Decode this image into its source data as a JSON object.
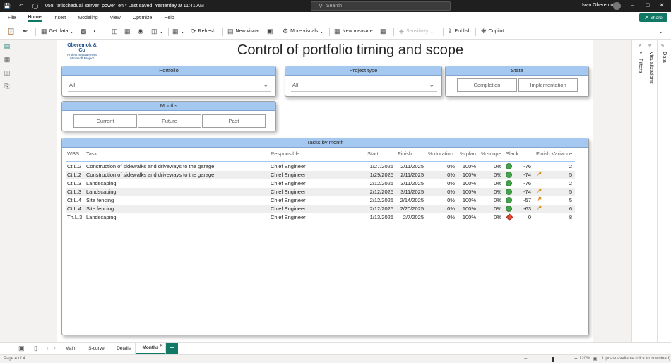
{
  "titlebar": {
    "title": "058_totlschedual_server_power_en * Last saved: Yesterday at 11:41 AM",
    "search_placeholder": "Search",
    "user_name": "Ivan Oberemok"
  },
  "menu": {
    "items": [
      "File",
      "Home",
      "Insert",
      "Modeling",
      "View",
      "Optimize",
      "Help"
    ],
    "active": "Home",
    "share_label": "Share"
  },
  "ribbon": {
    "get_data": "Get data",
    "refresh": "Refresh",
    "new_visual": "New visual",
    "more_visuals": "More visuals",
    "new_measure": "New measure",
    "sensitivity": "Sensitivity",
    "publish": "Publish",
    "copilot": "Copilot"
  },
  "report": {
    "logo_name": "Oberemok & Co",
    "logo_sub1": "Project management",
    "logo_sub2": "Microsoft Project",
    "title": "Control of portfolio timing and scope",
    "portfolio": {
      "header": "Portfolio",
      "value": "All"
    },
    "project_type": {
      "header": "Project type",
      "value": "All"
    },
    "state": {
      "header": "State",
      "buttons": [
        "Completion",
        "Implementation"
      ]
    },
    "months": {
      "header": "Months",
      "buttons": [
        "Current",
        "Future",
        "Past"
      ]
    },
    "tasks": {
      "header": "Tasks by month",
      "columns": [
        "WBS",
        "Task",
        "Responsible",
        "Start",
        "Finish",
        "% duration",
        "% plan",
        "% scope",
        "Slack",
        "Finish Variance"
      ],
      "rows": [
        {
          "wbs": "Ct.L.2",
          "task": "Construction of sidewalks and driveways to the garage",
          "responsible": "Chief Engineer",
          "start": "1/27/2025",
          "finish": "2/11/2025",
          "duration": "0%",
          "plan": "100%",
          "scope": "0%",
          "status": "green",
          "slack": "-76",
          "arrow": "down",
          "variance": "2"
        },
        {
          "wbs": "Ct.L.2",
          "task": "Construction of sidewalks and driveways to the garage",
          "responsible": "Chief Engineer",
          "start": "1/29/2025",
          "finish": "2/11/2025",
          "duration": "0%",
          "plan": "100%",
          "scope": "0%",
          "status": "green",
          "slack": "-74",
          "arrow": "up-right",
          "variance": "5"
        },
        {
          "wbs": "Ct.L.3",
          "task": "Landscaping",
          "responsible": "Chief Engineer",
          "start": "2/12/2025",
          "finish": "3/11/2025",
          "duration": "0%",
          "plan": "100%",
          "scope": "0%",
          "status": "green",
          "slack": "-76",
          "arrow": "down",
          "variance": "2"
        },
        {
          "wbs": "Ct.L.3",
          "task": "Landscaping",
          "responsible": "Chief Engineer",
          "start": "2/12/2025",
          "finish": "3/11/2025",
          "duration": "0%",
          "plan": "100%",
          "scope": "0%",
          "status": "green",
          "slack": "-74",
          "arrow": "up-right",
          "variance": "5"
        },
        {
          "wbs": "Ct.L.4",
          "task": "Site fencing",
          "responsible": "Chief Engineer",
          "start": "2/12/2025",
          "finish": "2/14/2025",
          "duration": "0%",
          "plan": "100%",
          "scope": "0%",
          "status": "green",
          "slack": "-57",
          "arrow": "up-right",
          "variance": "5"
        },
        {
          "wbs": "Ct.L.4",
          "task": "Site fencing",
          "responsible": "Chief Engineer",
          "start": "2/12/2025",
          "finish": "2/20/2025",
          "duration": "0%",
          "plan": "100%",
          "scope": "0%",
          "status": "green",
          "slack": "-63",
          "arrow": "up-right",
          "variance": "6"
        },
        {
          "wbs": "Th.L.3",
          "task": "Landscaping",
          "responsible": "Chief Engineer",
          "start": "1/13/2025",
          "finish": "2/7/2025",
          "duration": "0%",
          "plan": "100%",
          "scope": "0%",
          "status": "red",
          "slack": "0",
          "arrow": "up",
          "variance": "8"
        }
      ]
    }
  },
  "panes": {
    "filters": "Filters",
    "visualizations": "Visualizations",
    "data": "Data"
  },
  "page_tabs": {
    "items": [
      "Main",
      "S-curve",
      "Details",
      "Months"
    ],
    "active": "Months"
  },
  "status": {
    "page": "Page 4 of 4",
    "zoom": "120%",
    "zoom_fraction": 0.55,
    "update": "Update available (click to download)"
  },
  "colors": {
    "accent": "#117865",
    "header_blue": "#a4c8f0",
    "status_green": "#44a24d",
    "status_red": "#e04b36",
    "arrow_down": "#c0392b",
    "arrow_upright": "#d68a1e",
    "arrow_up": "#2e7d32"
  }
}
